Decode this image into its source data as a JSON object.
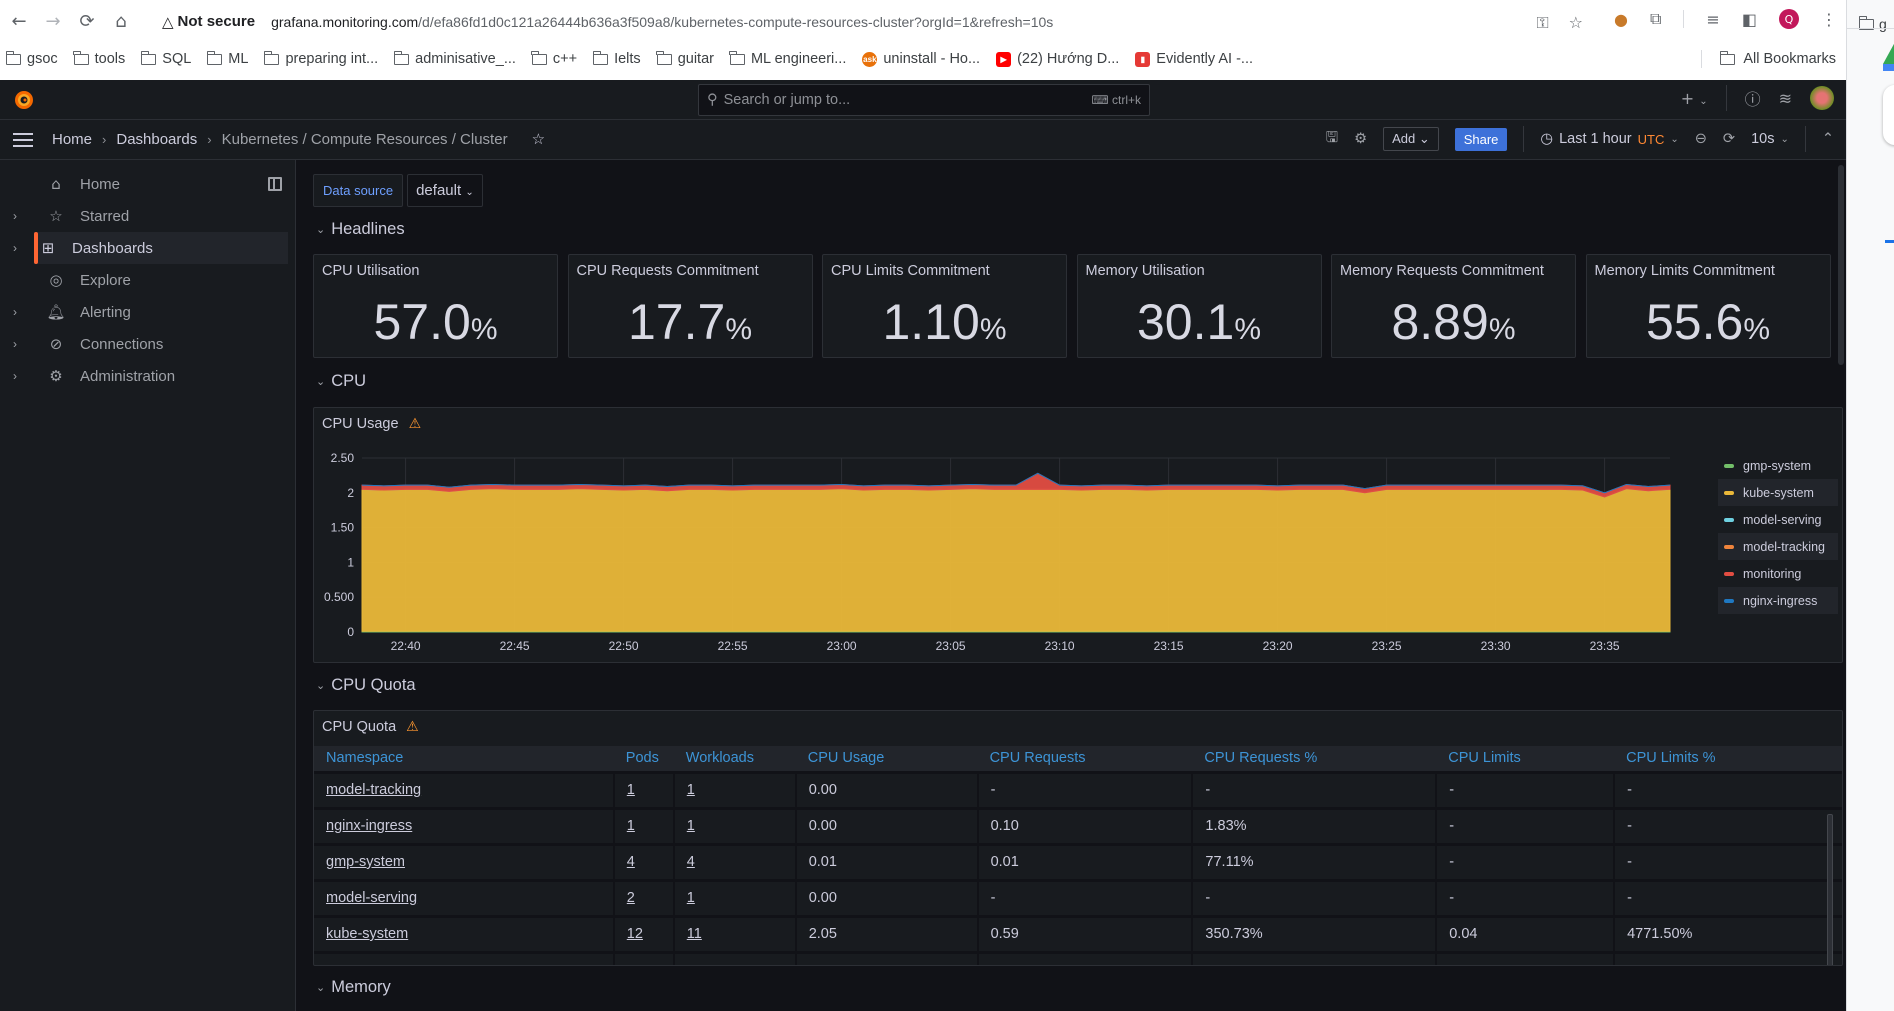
{
  "browser": {
    "nav": {
      "back": "←",
      "forward": "→",
      "reload": "⟳",
      "home": "⌂"
    },
    "security_label": "Not secure",
    "url_host": "grafana.monitoring.com",
    "url_path": "/d/efa86fd1d0c121a26444b636a3f509a8/kubernetes-compute-resources-cluster?orgId=1&refresh=10s",
    "profile_initial": "Q",
    "bookmarks": [
      {
        "label": "gsoc",
        "type": "folder"
      },
      {
        "label": "tools",
        "type": "folder"
      },
      {
        "label": "SQL",
        "type": "folder"
      },
      {
        "label": "ML",
        "type": "folder"
      },
      {
        "label": "preparing int...",
        "type": "folder"
      },
      {
        "label": "adminisative_...",
        "type": "folder"
      },
      {
        "label": "c++",
        "type": "folder"
      },
      {
        "label": "Ielts",
        "type": "folder"
      },
      {
        "label": "guitar",
        "type": "folder"
      },
      {
        "label": "ML engineeri...",
        "type": "folder"
      },
      {
        "label": "uninstall - Ho...",
        "type": "ask",
        "color": "#e8710a"
      },
      {
        "label": "(22) Hướng D...",
        "type": "youtube",
        "color": "#ff0000"
      },
      {
        "label": "Evidently AI -...",
        "type": "evidently",
        "color": "#e53935"
      }
    ],
    "all_bookmarks": "All Bookmarks",
    "side_window_bookmark": "g"
  },
  "topbar": {
    "search_placeholder": "Search or jump to...",
    "search_shortcut": "ctrl+k"
  },
  "breadcrumb": {
    "items": [
      "Home",
      "Dashboards",
      "Kubernetes / Compute Resources / Cluster"
    ]
  },
  "toolbar": {
    "add_label": "Add",
    "share_label": "Share",
    "time_range": "Last 1 hour",
    "timezone": "UTC",
    "refresh_interval": "10s"
  },
  "sidebar": {
    "items": [
      {
        "label": "Home",
        "icon": "⌂",
        "expandable": false
      },
      {
        "label": "Starred",
        "icon": "☆",
        "expandable": true
      },
      {
        "label": "Dashboards",
        "icon": "⊞",
        "expandable": true,
        "active": true
      },
      {
        "label": "Explore",
        "icon": "◎",
        "expandable": false
      },
      {
        "label": "Alerting",
        "icon": "🔔︎",
        "expandable": true
      },
      {
        "label": "Connections",
        "icon": "⊘",
        "expandable": true
      },
      {
        "label": "Administration",
        "icon": "⚙",
        "expandable": true
      }
    ]
  },
  "variables": {
    "datasource_label": "Data source",
    "datasource_value": "default"
  },
  "rows": {
    "headlines": "Headlines",
    "cpu": "CPU",
    "cpu_quota": "CPU Quota",
    "memory": "Memory"
  },
  "stats": [
    {
      "title": "CPU Utilisation",
      "value": "57.0",
      "unit": "%"
    },
    {
      "title": "CPU Requests Commitment",
      "value": "17.7",
      "unit": "%"
    },
    {
      "title": "CPU Limits Commitment",
      "value": "1.10",
      "unit": "%"
    },
    {
      "title": "Memory Utilisation",
      "value": "30.1",
      "unit": "%"
    },
    {
      "title": "Memory Requests Commitment",
      "value": "8.89",
      "unit": "%"
    },
    {
      "title": "Memory Limits Commitment",
      "value": "55.6",
      "unit": "%"
    }
  ],
  "cpu_usage_panel": {
    "title": "CPU Usage"
  },
  "chart_data": {
    "type": "area",
    "title": "CPU Usage",
    "stacked": true,
    "xlabel": "",
    "ylabel": "",
    "x_ticks": [
      "22:40",
      "22:45",
      "22:50",
      "22:55",
      "23:00",
      "23:05",
      "23:10",
      "23:15",
      "23:20",
      "23:25",
      "23:30",
      "23:35"
    ],
    "y_ticks": [
      "0",
      "0.500",
      "1",
      "1.50",
      "2",
      "2.50"
    ],
    "ylim": [
      0,
      2.5
    ],
    "x_range": [
      "22:38",
      "23:38"
    ],
    "grid": true,
    "legend_position": "right",
    "x": [
      0,
      1,
      2,
      3,
      4,
      5,
      6,
      7,
      8,
      9,
      10,
      11,
      12,
      13,
      14,
      15,
      16,
      17,
      18,
      19,
      20,
      21,
      22,
      23,
      24,
      25,
      26,
      27,
      28,
      29,
      30,
      31,
      32,
      33,
      34,
      35,
      36,
      37,
      38,
      39,
      40,
      41,
      42,
      43,
      44,
      45,
      46,
      47,
      48,
      49,
      50,
      51,
      52,
      53,
      54,
      55,
      56,
      57,
      58,
      59,
      60
    ],
    "series": [
      {
        "name": "gmp-system",
        "color": "#73bf69",
        "values": [
          0.01,
          0.01,
          0.01,
          0.01,
          0.01,
          0.01,
          0.01,
          0.01,
          0.01,
          0.01,
          0.01,
          0.01,
          0.01,
          0.01,
          0.01,
          0.01,
          0.01,
          0.01,
          0.01,
          0.01,
          0.01,
          0.01,
          0.01,
          0.01,
          0.01,
          0.01,
          0.01,
          0.01,
          0.01,
          0.01,
          0.01,
          0.01,
          0.01,
          0.01,
          0.01,
          0.01,
          0.01,
          0.01,
          0.01,
          0.01,
          0.01,
          0.01,
          0.01,
          0.01,
          0.01,
          0.01,
          0.01,
          0.01,
          0.01,
          0.01,
          0.01,
          0.01,
          0.01,
          0.01,
          0.01,
          0.01,
          0.01,
          0.01,
          0.01,
          0.01,
          0.01
        ]
      },
      {
        "name": "kube-system",
        "color": "#eab839",
        "values": [
          2.04,
          2.03,
          2.04,
          2.04,
          2.01,
          2.04,
          2.05,
          2.04,
          2.04,
          2.04,
          2.05,
          2.04,
          2.03,
          2.04,
          2.02,
          2.04,
          2.04,
          2.03,
          2.04,
          2.04,
          2.04,
          2.04,
          2.05,
          2.03,
          2.04,
          2.04,
          2.03,
          2.04,
          2.05,
          2.04,
          2.04,
          2.04,
          2.04,
          2.03,
          2.04,
          2.04,
          2.03,
          2.04,
          2.04,
          2.04,
          2.04,
          2.04,
          2.03,
          2.04,
          2.04,
          2.04,
          1.99,
          2.04,
          2.04,
          2.04,
          2.04,
          2.04,
          2.04,
          2.04,
          2.04,
          2.04,
          2.03,
          1.93,
          2.05,
          2.02,
          2.04
        ]
      },
      {
        "name": "model-serving",
        "color": "#6ed0e0",
        "values": [
          0,
          0,
          0,
          0,
          0,
          0,
          0,
          0,
          0,
          0,
          0,
          0,
          0,
          0,
          0,
          0,
          0,
          0,
          0,
          0,
          0,
          0,
          0,
          0,
          0,
          0,
          0,
          0,
          0,
          0,
          0,
          0,
          0,
          0,
          0,
          0,
          0,
          0,
          0,
          0,
          0,
          0,
          0,
          0,
          0,
          0,
          0,
          0,
          0,
          0,
          0,
          0,
          0,
          0,
          0,
          0,
          0,
          0,
          0,
          0,
          0
        ]
      },
      {
        "name": "model-tracking",
        "color": "#ef843c",
        "values": [
          0,
          0,
          0,
          0,
          0,
          0,
          0,
          0,
          0,
          0,
          0,
          0,
          0,
          0,
          0,
          0,
          0,
          0,
          0,
          0,
          0,
          0,
          0,
          0,
          0,
          0,
          0,
          0,
          0,
          0,
          0,
          0,
          0,
          0,
          0,
          0,
          0,
          0,
          0,
          0,
          0,
          0,
          0,
          0,
          0,
          0,
          0,
          0,
          0,
          0,
          0,
          0,
          0,
          0,
          0,
          0,
          0,
          0,
          0,
          0,
          0
        ]
      },
      {
        "name": "monitoring",
        "color": "#e24d42",
        "values": [
          0.06,
          0.06,
          0.06,
          0.06,
          0.06,
          0.06,
          0.06,
          0.06,
          0.06,
          0.06,
          0.06,
          0.06,
          0.06,
          0.06,
          0.06,
          0.06,
          0.06,
          0.06,
          0.06,
          0.06,
          0.06,
          0.06,
          0.06,
          0.06,
          0.06,
          0.06,
          0.06,
          0.06,
          0.06,
          0.06,
          0.06,
          0.23,
          0.06,
          0.06,
          0.06,
          0.06,
          0.06,
          0.06,
          0.06,
          0.06,
          0.06,
          0.06,
          0.06,
          0.06,
          0.06,
          0.06,
          0.06,
          0.06,
          0.06,
          0.06,
          0.06,
          0.06,
          0.06,
          0.06,
          0.06,
          0.06,
          0.06,
          0.06,
          0.06,
          0.06,
          0.06
        ]
      },
      {
        "name": "nginx-ingress",
        "color": "#1f78c1",
        "values": [
          0,
          0,
          0,
          0,
          0,
          0,
          0,
          0,
          0,
          0,
          0,
          0,
          0,
          0,
          0,
          0,
          0,
          0,
          0,
          0,
          0,
          0,
          0,
          0,
          0,
          0,
          0,
          0,
          0,
          0,
          0,
          0,
          0,
          0,
          0,
          0,
          0,
          0,
          0,
          0,
          0,
          0,
          0,
          0,
          0,
          0,
          0,
          0,
          0,
          0,
          0,
          0,
          0,
          0,
          0,
          0,
          0,
          0,
          0,
          0,
          0
        ]
      }
    ]
  },
  "cpu_quota_panel": {
    "title": "CPU Quota",
    "columns": [
      "Namespace",
      "Pods",
      "Workloads",
      "CPU Usage",
      "CPU Requests",
      "CPU Requests %",
      "CPU Limits",
      "CPU Limits %"
    ],
    "rows": [
      [
        "model-tracking",
        "1",
        "1",
        "0.00",
        "-",
        "-",
        "-",
        "-"
      ],
      [
        "nginx-ingress",
        "1",
        "1",
        "0.00",
        "0.10",
        "1.83%",
        "-",
        "-"
      ],
      [
        "gmp-system",
        "4",
        "4",
        "0.01",
        "0.01",
        "77.11%",
        "-",
        "-"
      ],
      [
        "model-serving",
        "2",
        "1",
        "0.00",
        "-",
        "-",
        "-",
        "-"
      ],
      [
        "kube-system",
        "12",
        "11",
        "2.05",
        "0.59",
        "350.73%",
        "0.04",
        "4771.50%"
      ]
    ]
  }
}
